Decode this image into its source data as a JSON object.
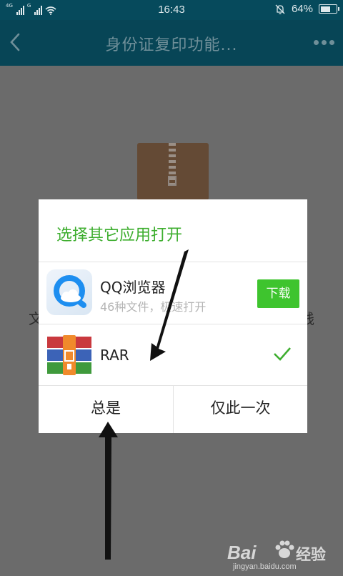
{
  "status_bar": {
    "network_1": "4G",
    "network_2": "G",
    "time": "16:43",
    "battery": "64%",
    "battery_level": 0.64
  },
  "header": {
    "title": "身份证复印功能..."
  },
  "background": {
    "left_text": "文",
    "right_text": "贱"
  },
  "dialog": {
    "title": "选择其它应用打开",
    "apps": [
      {
        "name": "QQ浏览器",
        "subtitle": "46种文件，极速打开",
        "action": "下载"
      },
      {
        "name": "RAR"
      }
    ],
    "buttons": {
      "always": "总是",
      "once": "仅此一次"
    }
  },
  "watermark": {
    "logo": "Bai",
    "brand": "经验",
    "url": "jingyan.baidu.com"
  },
  "colors": {
    "accent_green": "#3eae2f",
    "button_green": "#3ec42e",
    "header_bg": "#074556",
    "overlay": "#6b6b6b"
  }
}
